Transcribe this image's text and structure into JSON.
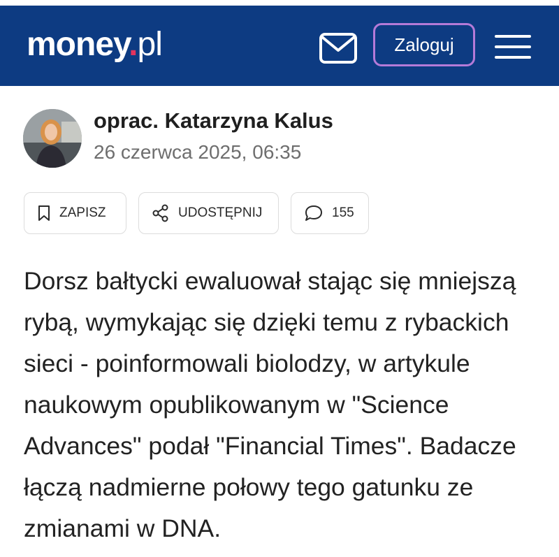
{
  "header": {
    "logo_main": "money",
    "logo_dot": ".",
    "logo_tld": "pl",
    "login_label": "Zaloguj",
    "mail_icon": "envelope-icon",
    "menu_icon": "hamburger-menu-icon",
    "background_color": "#0d3b82",
    "accent_color": "#e2335e",
    "login_border_color": "#b47ad8"
  },
  "article": {
    "author": "oprac. Katarzyna Kalus",
    "date": "26 czerwca 2025, 06:35",
    "actions": {
      "save_label": "ZAPISZ",
      "share_label": "UDOSTĘPNIJ",
      "comments_count": "155"
    },
    "lead": "Dorsz bałtycki ewaluował stając się mniejszą rybą, wymykając się dzięki temu z rybackich sieci - poinformowali biolodzy, w artykule naukowym opublikowanym w \"Science Advances\" podał \"Financial Times\". Badacze łączą nadmierne połowy tego gatunku ze zmianami w DNA."
  }
}
